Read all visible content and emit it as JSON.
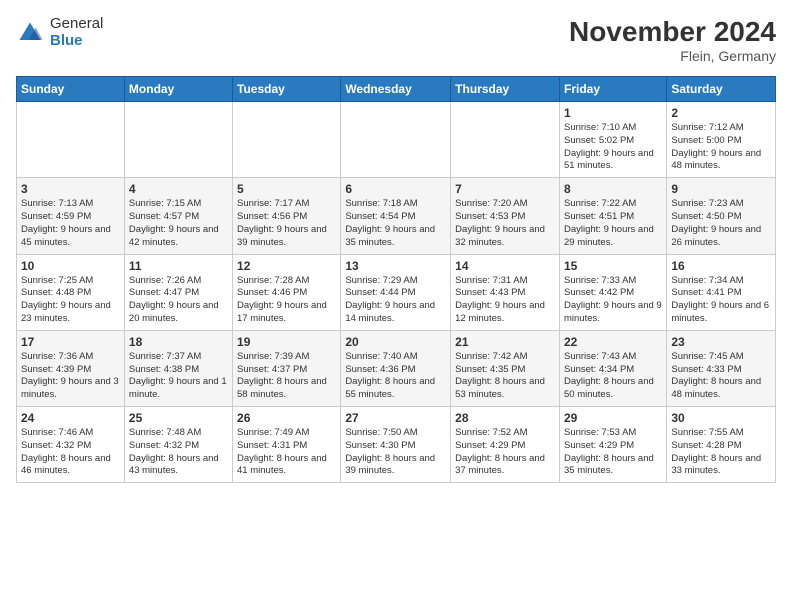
{
  "logo": {
    "general": "General",
    "blue": "Blue"
  },
  "title": "November 2024",
  "subtitle": "Flein, Germany",
  "days_header": [
    "Sunday",
    "Monday",
    "Tuesday",
    "Wednesday",
    "Thursday",
    "Friday",
    "Saturday"
  ],
  "weeks": [
    [
      {
        "day": "",
        "info": ""
      },
      {
        "day": "",
        "info": ""
      },
      {
        "day": "",
        "info": ""
      },
      {
        "day": "",
        "info": ""
      },
      {
        "day": "",
        "info": ""
      },
      {
        "day": "1",
        "info": "Sunrise: 7:10 AM\nSunset: 5:02 PM\nDaylight: 9 hours and 51 minutes."
      },
      {
        "day": "2",
        "info": "Sunrise: 7:12 AM\nSunset: 5:00 PM\nDaylight: 9 hours and 48 minutes."
      }
    ],
    [
      {
        "day": "3",
        "info": "Sunrise: 7:13 AM\nSunset: 4:59 PM\nDaylight: 9 hours and 45 minutes."
      },
      {
        "day": "4",
        "info": "Sunrise: 7:15 AM\nSunset: 4:57 PM\nDaylight: 9 hours and 42 minutes."
      },
      {
        "day": "5",
        "info": "Sunrise: 7:17 AM\nSunset: 4:56 PM\nDaylight: 9 hours and 39 minutes."
      },
      {
        "day": "6",
        "info": "Sunrise: 7:18 AM\nSunset: 4:54 PM\nDaylight: 9 hours and 35 minutes."
      },
      {
        "day": "7",
        "info": "Sunrise: 7:20 AM\nSunset: 4:53 PM\nDaylight: 9 hours and 32 minutes."
      },
      {
        "day": "8",
        "info": "Sunrise: 7:22 AM\nSunset: 4:51 PM\nDaylight: 9 hours and 29 minutes."
      },
      {
        "day": "9",
        "info": "Sunrise: 7:23 AM\nSunset: 4:50 PM\nDaylight: 9 hours and 26 minutes."
      }
    ],
    [
      {
        "day": "10",
        "info": "Sunrise: 7:25 AM\nSunset: 4:48 PM\nDaylight: 9 hours and 23 minutes."
      },
      {
        "day": "11",
        "info": "Sunrise: 7:26 AM\nSunset: 4:47 PM\nDaylight: 9 hours and 20 minutes."
      },
      {
        "day": "12",
        "info": "Sunrise: 7:28 AM\nSunset: 4:46 PM\nDaylight: 9 hours and 17 minutes."
      },
      {
        "day": "13",
        "info": "Sunrise: 7:29 AM\nSunset: 4:44 PM\nDaylight: 9 hours and 14 minutes."
      },
      {
        "day": "14",
        "info": "Sunrise: 7:31 AM\nSunset: 4:43 PM\nDaylight: 9 hours and 12 minutes."
      },
      {
        "day": "15",
        "info": "Sunrise: 7:33 AM\nSunset: 4:42 PM\nDaylight: 9 hours and 9 minutes."
      },
      {
        "day": "16",
        "info": "Sunrise: 7:34 AM\nSunset: 4:41 PM\nDaylight: 9 hours and 6 minutes."
      }
    ],
    [
      {
        "day": "17",
        "info": "Sunrise: 7:36 AM\nSunset: 4:39 PM\nDaylight: 9 hours and 3 minutes."
      },
      {
        "day": "18",
        "info": "Sunrise: 7:37 AM\nSunset: 4:38 PM\nDaylight: 9 hours and 1 minute."
      },
      {
        "day": "19",
        "info": "Sunrise: 7:39 AM\nSunset: 4:37 PM\nDaylight: 8 hours and 58 minutes."
      },
      {
        "day": "20",
        "info": "Sunrise: 7:40 AM\nSunset: 4:36 PM\nDaylight: 8 hours and 55 minutes."
      },
      {
        "day": "21",
        "info": "Sunrise: 7:42 AM\nSunset: 4:35 PM\nDaylight: 8 hours and 53 minutes."
      },
      {
        "day": "22",
        "info": "Sunrise: 7:43 AM\nSunset: 4:34 PM\nDaylight: 8 hours and 50 minutes."
      },
      {
        "day": "23",
        "info": "Sunrise: 7:45 AM\nSunset: 4:33 PM\nDaylight: 8 hours and 48 minutes."
      }
    ],
    [
      {
        "day": "24",
        "info": "Sunrise: 7:46 AM\nSunset: 4:32 PM\nDaylight: 8 hours and 46 minutes."
      },
      {
        "day": "25",
        "info": "Sunrise: 7:48 AM\nSunset: 4:32 PM\nDaylight: 8 hours and 43 minutes."
      },
      {
        "day": "26",
        "info": "Sunrise: 7:49 AM\nSunset: 4:31 PM\nDaylight: 8 hours and 41 minutes."
      },
      {
        "day": "27",
        "info": "Sunrise: 7:50 AM\nSunset: 4:30 PM\nDaylight: 8 hours and 39 minutes."
      },
      {
        "day": "28",
        "info": "Sunrise: 7:52 AM\nSunset: 4:29 PM\nDaylight: 8 hours and 37 minutes."
      },
      {
        "day": "29",
        "info": "Sunrise: 7:53 AM\nSunset: 4:29 PM\nDaylight: 8 hours and 35 minutes."
      },
      {
        "day": "30",
        "info": "Sunrise: 7:55 AM\nSunset: 4:28 PM\nDaylight: 8 hours and 33 minutes."
      }
    ]
  ]
}
